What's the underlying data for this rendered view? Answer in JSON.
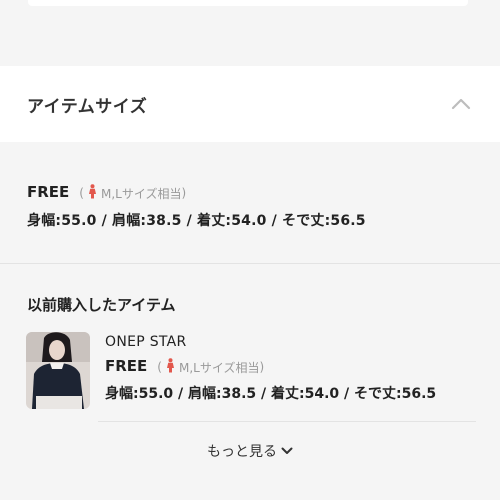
{
  "section": {
    "title": "アイテムサイズ",
    "collapse_icon": "chevron-up-icon"
  },
  "item_size": {
    "name": "FREE",
    "paren_open": "(",
    "paren_close": ")",
    "equivalent": "M,Lサイズ相当",
    "equivalent_icon": "woman-figure-icon",
    "measurements": "身幅:55.0 / 肩幅:38.5 / 着丈:54.0 / そで丈:56.5"
  },
  "previous": {
    "title": "以前購入したアイテム",
    "items": [
      {
        "brand": "ONEP STAR",
        "size": "FREE",
        "paren_open": "(",
        "paren_close": ")",
        "equivalent": "M,Lサイズ相当",
        "measurements": "身幅:55.0 / 肩幅:38.5 / 着丈:54.0 / そで丈:56.5"
      }
    ]
  },
  "more_label": "もっと見る",
  "colors": {
    "accent_figure": "#e2574c",
    "muted_text": "#9a9a9a",
    "background": "#f5f5f5"
  }
}
